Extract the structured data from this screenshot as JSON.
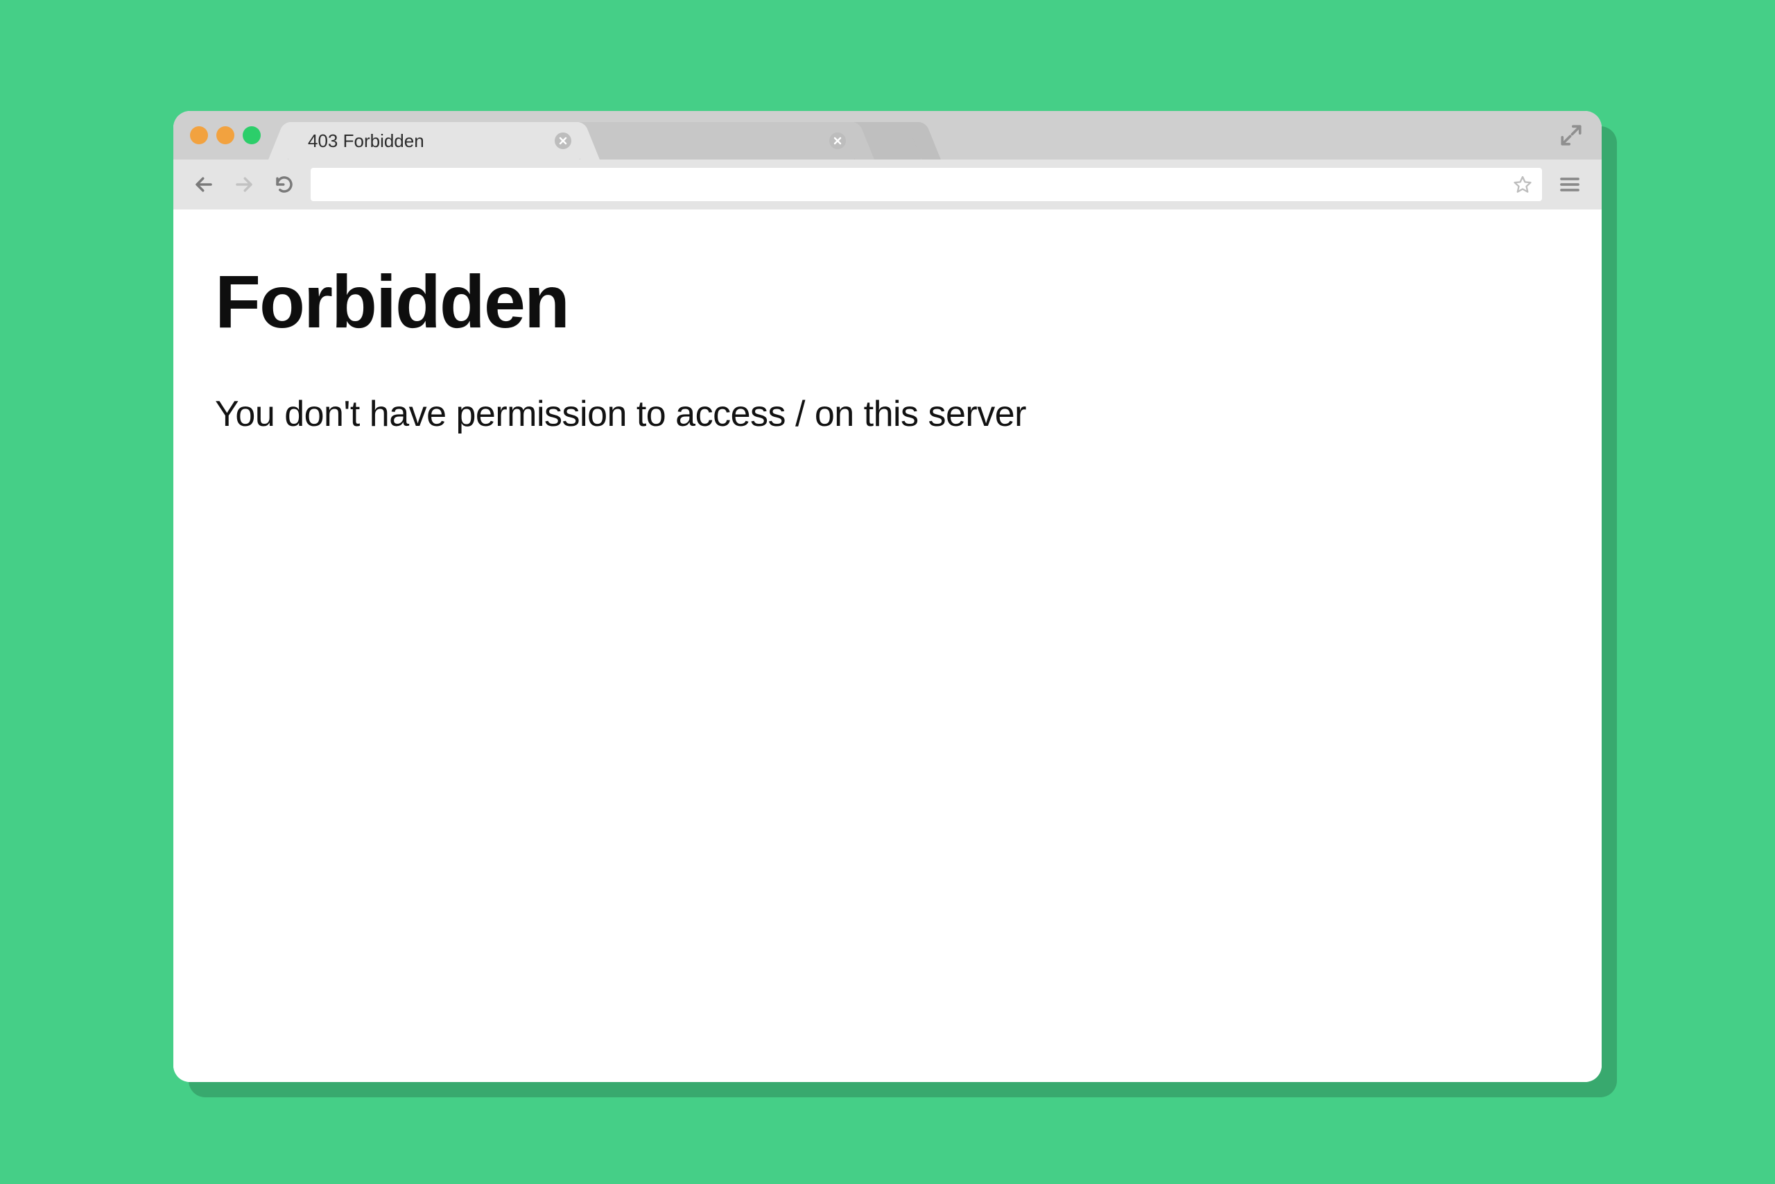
{
  "window": {
    "traffic_lights": [
      "close",
      "minimize",
      "zoom"
    ]
  },
  "tabs": {
    "active_label": "403 Forbidden"
  },
  "toolbar": {
    "address_value": "",
    "address_placeholder": ""
  },
  "page": {
    "heading": "Forbidden",
    "message": "You don't have permission to access / on this server"
  }
}
